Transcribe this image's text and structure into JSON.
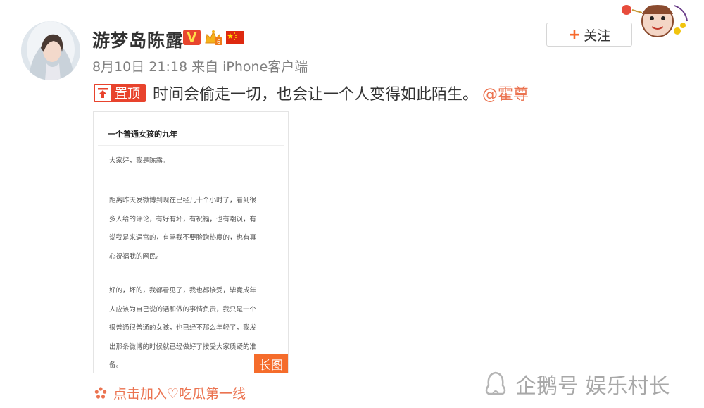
{
  "user": {
    "name": "游梦岛陈露",
    "verified_label": "V"
  },
  "follow_button": {
    "plus": "+",
    "label": "关注"
  },
  "post": {
    "meta": "8月10日 21:18 来自 iPhone客户端",
    "pin_label": "置顶",
    "text": "时间会偷走一切，也会让一个人变得如此陌生。",
    "mention": "@霍尊"
  },
  "long_image": {
    "title": "一个普通女孩的九年",
    "paragraphs": [
      [
        "大家好，我是陈露。"
      ],
      [
        "距离昨天发微博到现在已经几十个小时了，看到很",
        "多人给的评论，有好有坏，有祝福，也有嘲讽，有",
        "说我是来逼宫的，有骂我不要脸蹭热度的，也有真",
        "心祝福我的网民。"
      ],
      [
        "好的，坏的，我都看见了，我也都接受，毕竟成年",
        "人应该为自己说的话和做的事情负责，我只是一个",
        "很普通很普通的女孩，也已经不那么年轻了，我发",
        "出那条微博的时候就已经做好了接受大家质疑的准",
        "备。"
      ]
    ],
    "tag": "长图"
  },
  "recommend": {
    "text": "点击加入♡吃瓜第一线"
  },
  "watermark": {
    "text": "企鹅号 娱乐村长"
  },
  "colors": {
    "accent": "#eb7350",
    "pin_red": "#e8432d",
    "tag_orange": "#f56c2b"
  }
}
